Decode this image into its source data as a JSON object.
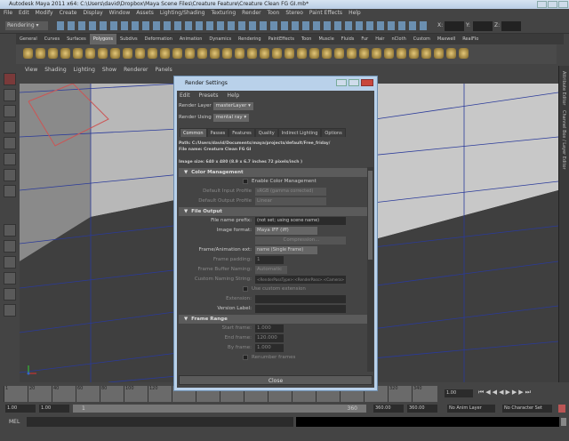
{
  "window": {
    "title": "Autodesk Maya 2011 x64: C:\\Users\\david\\Dropbox\\Maya Scene Files\\Creature Feature\\Creature Clean FG GI.mb*"
  },
  "menubar": [
    "File",
    "Edit",
    "Modify",
    "Create",
    "Display",
    "Window",
    "Assets",
    "Lighting/Shading",
    "Texturing",
    "Render",
    "Toon",
    "Stereo",
    "Paint Effects",
    "Help"
  ],
  "status_line": {
    "menu_set": "Rendering",
    "x_label": "X:",
    "y_label": "Y:",
    "z_label": "Z:"
  },
  "shelf_tabs": [
    "General",
    "Curves",
    "Surfaces",
    "Polygons",
    "Subdivs",
    "Deformation",
    "Animation",
    "Dynamics",
    "Rendering",
    "PaintEffects",
    "Toon",
    "Muscle",
    "Fluids",
    "Fur",
    "Hair",
    "nCloth",
    "Custom",
    "Maxwell",
    "RealFlo"
  ],
  "shelf_active": "Polygons",
  "panel_menu": [
    "View",
    "Shading",
    "Lighting",
    "Show",
    "Renderer",
    "Panels"
  ],
  "right_dock": [
    "Attribute Editor",
    "Channel Box / Layer Editor"
  ],
  "timeline": {
    "ticks": [
      "1",
      "20",
      "40",
      "60",
      "80",
      "100",
      "120",
      "",
      "",
      "",
      "",
      "",
      "",
      "",
      "",
      "",
      "320",
      "340"
    ],
    "current_frame": "1.00"
  },
  "range": {
    "start": "1.00",
    "playback_start": "1.00",
    "slider_start": "1",
    "slider_end": "360",
    "playback_end": "360.00",
    "end": "360.00",
    "anim_layer": "No Anim Layer",
    "character_set": "No Character Set"
  },
  "mel": {
    "label": "MEL"
  },
  "dialog": {
    "title": "Render Settings",
    "menu": [
      "Edit",
      "Presets",
      "Help"
    ],
    "render_layer_label": "Render Layer",
    "render_layer": "masterLayer",
    "render_using_label": "Render Using",
    "render_using": "mental ray",
    "tabs": [
      "Common",
      "Passes",
      "Features",
      "Quality",
      "Indirect Lighting",
      "Options"
    ],
    "active_tab": "Common",
    "path": "Path: C:/Users/david/Documents/maya/projects/default/Free_friday/",
    "file_name": "File name:  Creature Clean FG GI",
    "image_size": "Image size: 640 x 480 (8.9 x 6.7 inches 72 pixels/inch )",
    "color_management": {
      "title": "Color Management",
      "enable": "Enable Color Management",
      "input_label": "Default Input Profile",
      "input": "sRGB (gamma corrected)",
      "output_label": "Default Output Profile",
      "output": "Linear"
    },
    "file_output": {
      "title": "File Output",
      "prefix_label": "File name prefix:",
      "prefix": "(not set; using scene name)",
      "format_label": "Image format:",
      "format": "Maya IFF (iff)",
      "compression": "Compression...",
      "ext_label": "Frame/Animation ext:",
      "ext": "name (Single Frame)",
      "padding_label": "Frame padding:",
      "padding": "1",
      "fb_label": "Frame Buffer Naming:",
      "fb": "Automatic",
      "custom_label": "Custom Naming String:",
      "custom": "<RenderPassType>:<RenderPass>.<Camera>",
      "use_ext": "Use custom extension",
      "extension_label": "Extension:",
      "version_label": "Version Label:"
    },
    "frame_range": {
      "title": "Frame Range",
      "start_label": "Start frame:",
      "start": "1.000",
      "end_label": "End frame:",
      "end": "120.000",
      "by_label": "By frame:",
      "by": "1.000",
      "renumber": "Renumber frames"
    },
    "close": "Close"
  }
}
